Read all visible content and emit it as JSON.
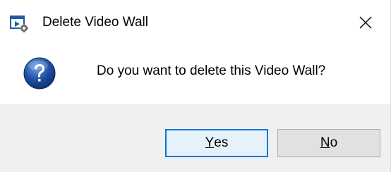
{
  "window": {
    "title": "Delete Video Wall",
    "app_icon": "video-wall-app-icon",
    "close_icon": "close-icon"
  },
  "content": {
    "icon": "question-icon",
    "message": "Do you want to delete this Video Wall?"
  },
  "buttons": {
    "yes": {
      "mnemonic": "Y",
      "rest": "es",
      "default": true
    },
    "no": {
      "mnemonic": "N",
      "rest": "o",
      "default": false
    }
  },
  "colors": {
    "accent": "#0078d7",
    "footer_bg": "#f0f0f0",
    "button_bg": "#e1e1e1",
    "question_blue": "#1f4fa3"
  }
}
